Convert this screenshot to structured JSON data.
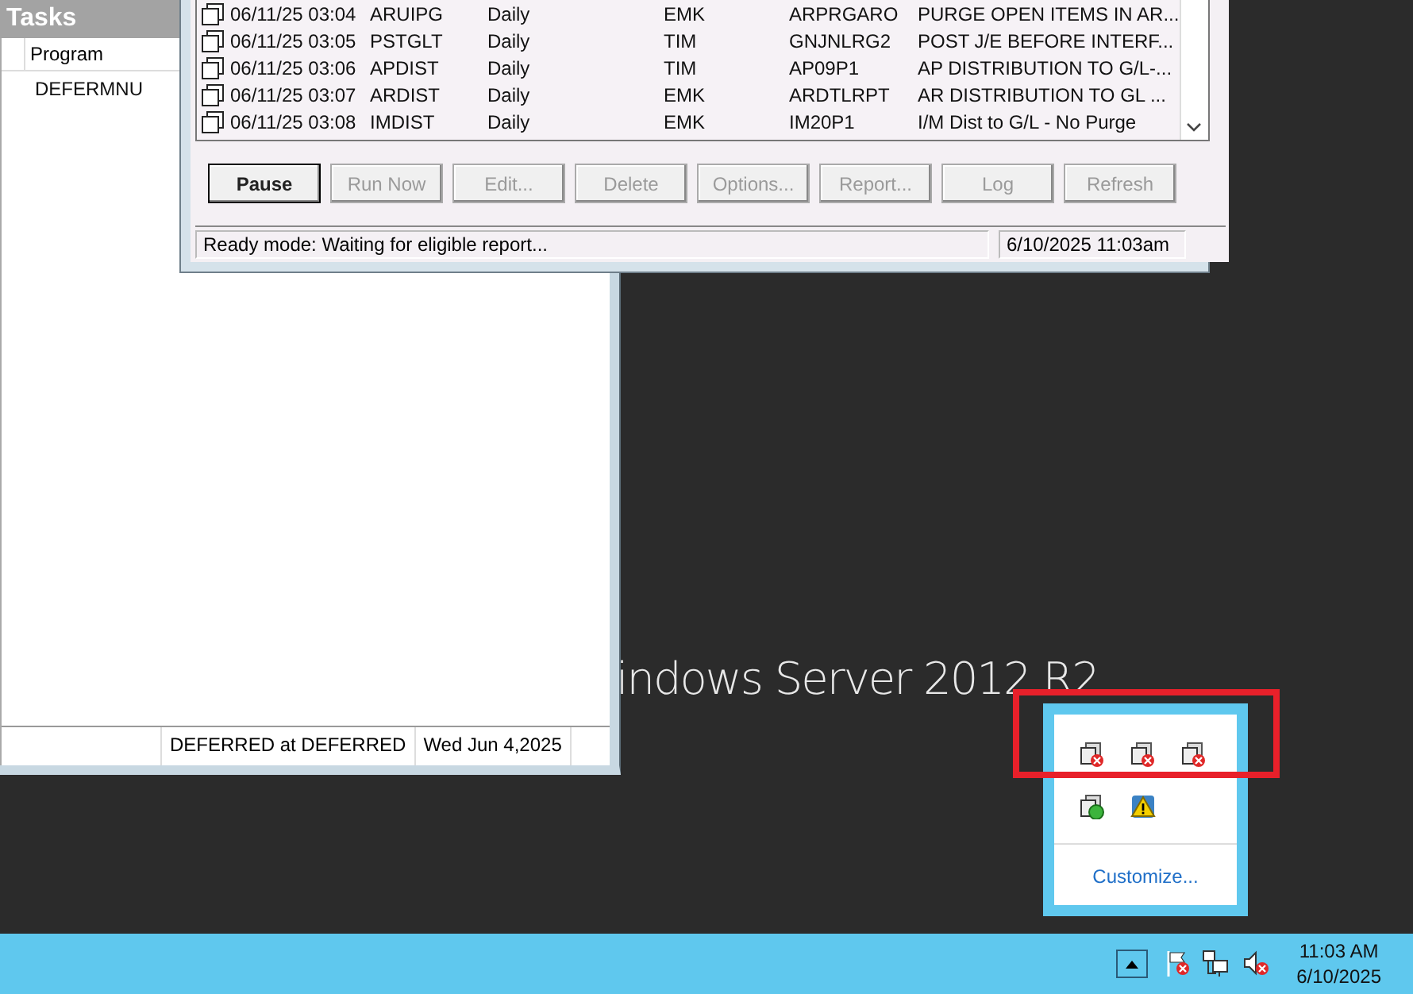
{
  "tasks_window": {
    "title": "Tasks",
    "columns": [
      "Program"
    ],
    "rows": [
      {
        "program": "DEFERMNU"
      }
    ],
    "status_bar": [
      "DEFERRED at DEFERRED",
      "Wed Jun 4,2025"
    ]
  },
  "scheduler_window": {
    "rows": [
      {
        "datetime": "06/11/25 03:04",
        "program": "ARUIPG",
        "frequency": "Daily",
        "user": "EMK",
        "code": "ARPRGARO",
        "description": "PURGE OPEN ITEMS IN AR..."
      },
      {
        "datetime": "06/11/25 03:05",
        "program": "PSTGLT",
        "frequency": "Daily",
        "user": "TIM",
        "code": "GNJNLRG2",
        "description": "POST J/E BEFORE INTERF..."
      },
      {
        "datetime": "06/11/25 03:06",
        "program": "APDIST",
        "frequency": "Daily",
        "user": "TIM",
        "code": "AP09P1",
        "description": "AP DISTRIBUTION TO G/L-..."
      },
      {
        "datetime": "06/11/25 03:07",
        "program": "ARDIST",
        "frequency": "Daily",
        "user": "EMK",
        "code": "ARDTLRPT",
        "description": "AR DISTRIBUTION TO GL ..."
      },
      {
        "datetime": "06/11/25 03:08",
        "program": "IMDIST",
        "frequency": "Daily",
        "user": "EMK",
        "code": "IM20P1",
        "description": "I/M Dist to G/L - No Purge"
      }
    ],
    "buttons": [
      {
        "label": "Pause",
        "disabled": false,
        "default": true
      },
      {
        "label": "Run Now",
        "disabled": true,
        "default": false
      },
      {
        "label": "Edit...",
        "disabled": true,
        "default": false
      },
      {
        "label": "Delete",
        "disabled": true,
        "default": false
      },
      {
        "label": "Options...",
        "disabled": true,
        "default": false
      },
      {
        "label": "Report...",
        "disabled": true,
        "default": false
      },
      {
        "label": "Log",
        "disabled": true,
        "default": false
      },
      {
        "label": "Refresh",
        "disabled": true,
        "default": false
      }
    ],
    "status_bar": {
      "message": "Ready mode: Waiting for eligible report...",
      "datetime": "6/10/2025 11:03am"
    }
  },
  "desktop": {
    "branding": "indows Server 2012 R2"
  },
  "annotation": {
    "kind": "rectangle"
  },
  "tray_popup": {
    "icons": [
      {
        "kind": "app-error"
      },
      {
        "kind": "app-error"
      },
      {
        "kind": "app-error"
      },
      {
        "kind": "app-sync"
      },
      {
        "kind": "warning"
      }
    ],
    "link": "Customize..."
  },
  "taskbar": {
    "tray_icons": [
      {
        "kind": "flag-error"
      },
      {
        "kind": "network"
      },
      {
        "kind": "speaker-error"
      }
    ],
    "time": "11:03 AM",
    "date": "6/10/2025"
  }
}
